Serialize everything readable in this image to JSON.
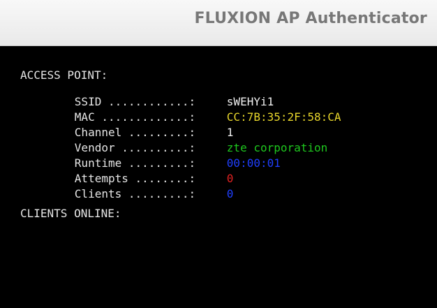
{
  "window": {
    "title": "FLUXION AP Authenticator"
  },
  "terminal": {
    "access_point_header": "ACCESS POINT:",
    "rows": [
      {
        "label": "SSID ............:",
        "value": "sWEHYi1",
        "color": "#f0f0f0"
      },
      {
        "label": "MAC .............:",
        "value": "CC:7B:35:2F:58:CA",
        "color": "#e8d62b"
      },
      {
        "label": "Channel .........:",
        "value": "1",
        "color": "#f0f0f0"
      },
      {
        "label": "Vendor ..........:",
        "value": "zte corporation",
        "color": "#1ec81e"
      },
      {
        "label": "Runtime .........:",
        "value": "00:00:01",
        "color": "#1f3fff"
      },
      {
        "label": "Attempts ........:",
        "value": "0",
        "color": "#e22222"
      },
      {
        "label": "Clients .........:",
        "value": "0",
        "color": "#1f3fff"
      }
    ],
    "clients_online_header": "CLIENTS ONLINE:"
  }
}
